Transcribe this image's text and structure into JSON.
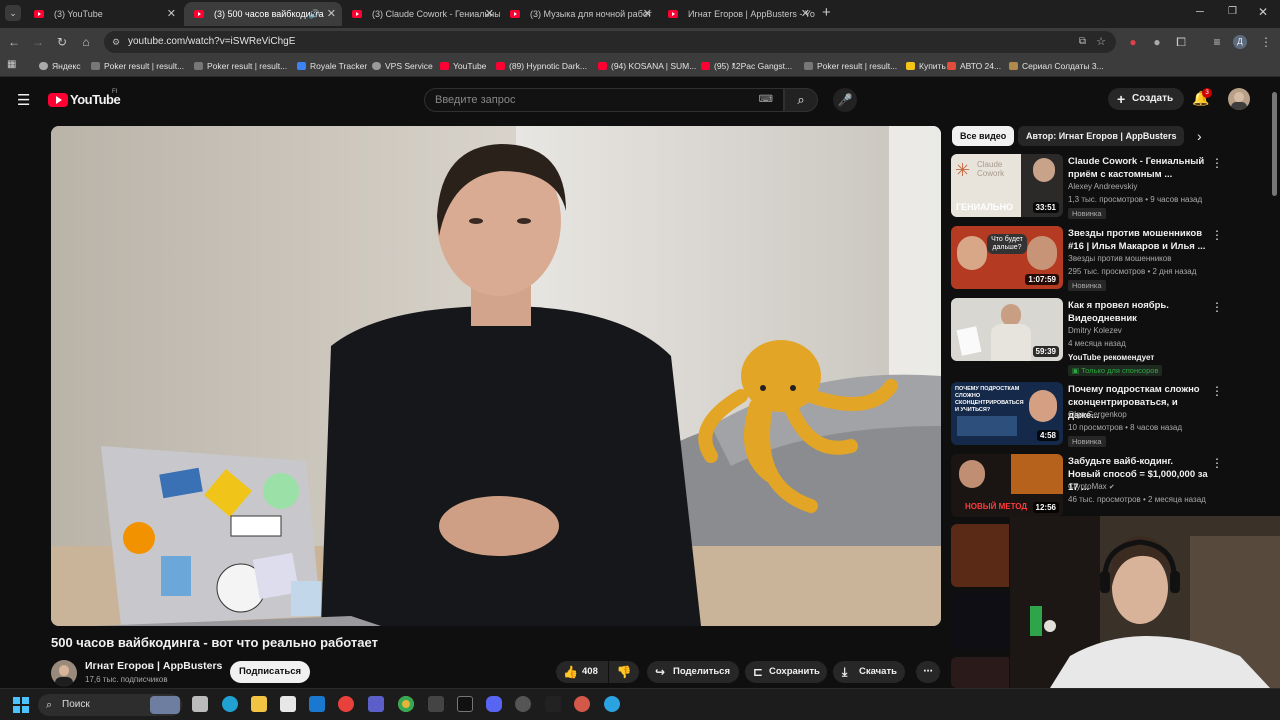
{
  "browser": {
    "tabs": [
      {
        "title": "(3) YouTube"
      },
      {
        "title": "(3) 500 часов вайбкодинга"
      },
      {
        "title": "(3) Claude Cowork - Гениальны"
      },
      {
        "title": "(3) Музыка для ночной работ"
      },
      {
        "title": "Игнат Егоров | AppBusters - Yo"
      }
    ],
    "new_tab": "+",
    "url": "youtube.com/watch?v=iSWReViChgE",
    "bookmarks": [
      "Яндекс",
      "Poker result | result...",
      "Poker result | result...",
      "Royale Tracker",
      "VPS Service",
      "YouTube",
      "(89) Hypnotic Dark...",
      "(94) KOSANA | SUM...",
      "(95) 🕱2Pac Gangst...",
      "Poker result | result...",
      "Купить",
      "АВТО 24...",
      "Сериал Солдаты 3..."
    ],
    "profile_letter": "Д"
  },
  "youtube": {
    "logo": "YouTube",
    "logo_region": "FI",
    "search_placeholder": "Введите запрос",
    "create_label": "Создать",
    "notifications_count": "3"
  },
  "video": {
    "title": "500 часов вайбкодинга - вот что реально работает",
    "channel": "Игнат Егоров | AppBusters",
    "subscribers": "17,6 тыс. подписчиков",
    "subscribe_label": "Подписаться",
    "likes": "408",
    "share_label": "Поделиться",
    "save_label": "Сохранить",
    "download_label": "Скачать"
  },
  "chips": [
    "Все видео",
    "Автор: Игнат Егоров | AppBusters"
  ],
  "recommendations": [
    {
      "title": "Claude Cowork - Гениальный приём с кастомным ...",
      "author": "Alexey Andreevskiy",
      "meta": "1,3 тыс. просмотров • 9 часов назад",
      "badge": "Новинка",
      "duration": "33:51",
      "thumb_text": "ГЕНИАЛЬНО",
      "thumb_brand": "Claude Cowork"
    },
    {
      "title": "Звезды против мошенников #16 | Илья Макаров и Илья ...",
      "author": "Звезды против мошенников",
      "meta": "295 тыс. просмотров • 2 дня назад",
      "badge": "Новинка",
      "duration": "1:07:59",
      "thumb_text": "Что будет дальше?"
    },
    {
      "title": "Как я провел ноябрь. Видеодневник",
      "author": "Dmitry Kolezev",
      "meta": "4 месяца назад",
      "extra": "YouTube рекомендует",
      "sponsor": "Только для спонсоров",
      "duration": "59:39"
    },
    {
      "title": "Почему подросткам сложно сконцентрироваться, и даже...",
      "author": "Olga Gergenkop",
      "meta": "10 просмотров • 8 часов назад",
      "badge": "Новинка",
      "duration": "4:58",
      "thumb_text": "ПОЧЕМУ ПОДРОСТКАМ СЛОЖНО СКОНЦЕНТРИРОВАТЬСЯ И УЧИТЬСЯ?"
    },
    {
      "title": "Забудьте вайб-кодинг. Новый способ = $1,000,000 за 17 ...",
      "author": "CryptoMax",
      "meta": "46 тыс. просмотров • 2 месяца назад",
      "duration": "12:56",
      "thumb_text": "НОВЫЙ МЕТОД"
    }
  ],
  "taskbar": {
    "search_label": "Поиск"
  }
}
